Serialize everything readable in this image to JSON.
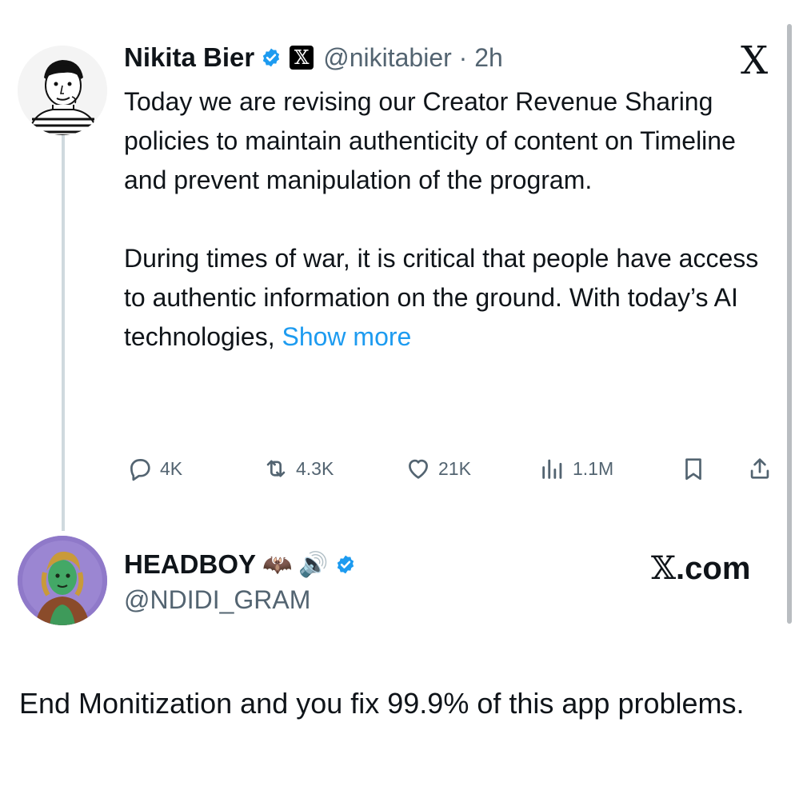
{
  "original_tweet": {
    "author_name": "Nikita Bier",
    "affiliate_badge": "𝕏",
    "handle_time": "@nikitabier · 2h",
    "paragraphs": [
      "Today we are revising our Creator Revenue Sharing policies to maintain authenticity of content on Timeline and prevent manipulation of the program.",
      "During times of war, it is critical that people have access to authentic information on the ground. With today’s AI technologies,"
    ],
    "show_more_label": "Show more",
    "x_logo": "X",
    "actions": {
      "replies": "4K",
      "reposts": "4.3K",
      "likes": "21K",
      "views": "1.1M"
    }
  },
  "reply_tweet": {
    "author_name": "HEADBOY",
    "emojis": [
      "🦇",
      "🔊"
    ],
    "handle": "@NDIDI_GRAM",
    "source_label": "𝕏",
    "source_suffix": ".com",
    "text": "End Monitization and you fix 99.9% of this app problems."
  },
  "icons": {
    "verified": "verified-badge-icon",
    "reply": "reply-icon",
    "repost": "repost-icon",
    "like": "heart-icon",
    "views": "views-chart-icon",
    "bookmark": "bookmark-icon",
    "share": "share-icon"
  },
  "colors": {
    "link": "#1d9bf0",
    "secondary_text": "#536471",
    "thread_line": "#cfd9de",
    "headboy_avatar_bg": "#8f79c9"
  }
}
